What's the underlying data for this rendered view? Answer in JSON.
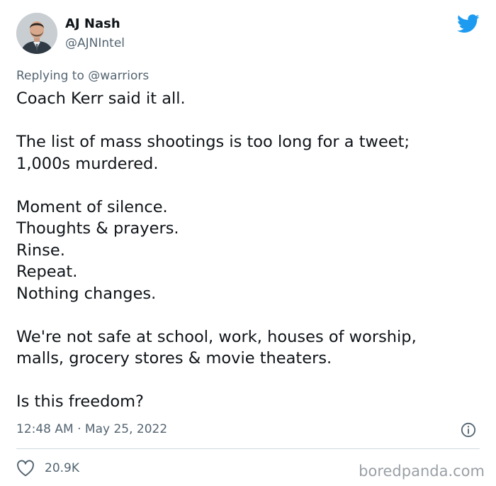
{
  "author": {
    "name": "AJ Nash",
    "handle": "@AJNIntel"
  },
  "reply_context": {
    "prefix": "Replying to",
    "mention": "@warriors"
  },
  "tweet": {
    "paragraphs": [
      [
        "Coach Kerr said it all."
      ],
      [
        "The list of mass shootings is too long for a tweet;",
        "1,000s murdered."
      ],
      [
        "Moment of silence.",
        "Thoughts & prayers.",
        "Rinse.",
        "Repeat.",
        "Nothing changes."
      ],
      [
        "We're not safe at school, work, houses of worship,",
        "malls, grocery stores & movie theaters."
      ],
      [
        "Is this freedom?"
      ]
    ]
  },
  "meta": {
    "time": "12:48 AM",
    "separator": "·",
    "date": "May 25, 2022"
  },
  "likes": {
    "count": "20.9K",
    "icon": "heart-icon"
  },
  "watermark": "boredpanda.com",
  "colors": {
    "text": "#0f1419",
    "secondary": "#536471",
    "twitter_blue": "#1d9bf0",
    "divider": "#cfd9de"
  }
}
